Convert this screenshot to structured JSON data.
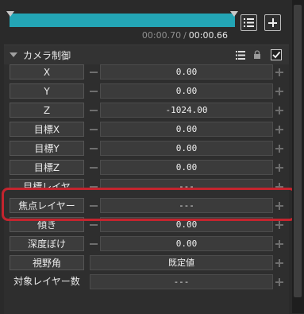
{
  "timeline": {
    "progress": 1.0,
    "current_time": "00:00.70",
    "separator": "/",
    "total_time": "00:00.66"
  },
  "icons": {
    "list": "list-icon",
    "add": "plus-icon",
    "collapse": "triangle-down-icon",
    "lock": "lock-icon",
    "check": "checkmark-icon"
  },
  "colors": {
    "accent": "#23a5b5",
    "highlight": "#c4242e"
  },
  "section": {
    "title": "カメラ制御",
    "enabled": true
  },
  "rows": [
    {
      "label": "X",
      "value": "0.00"
    },
    {
      "label": "Y",
      "value": "0.00"
    },
    {
      "label": "Z",
      "value": "-1024.00"
    },
    {
      "label": "目標X",
      "value": "0.00"
    },
    {
      "label": "目標Y",
      "value": "0.00"
    },
    {
      "label": "目標Z",
      "value": "0.00"
    },
    {
      "label": "目標レイヤ",
      "value": "---"
    },
    {
      "label": "焦点レイヤー",
      "value": "---"
    },
    {
      "label": "傾き",
      "value": "0.00"
    },
    {
      "label": "深度ぼけ",
      "value": "0.00"
    },
    {
      "label": "視野角",
      "value": "既定値"
    },
    {
      "label": "対象レイヤー数",
      "value": "---"
    }
  ]
}
